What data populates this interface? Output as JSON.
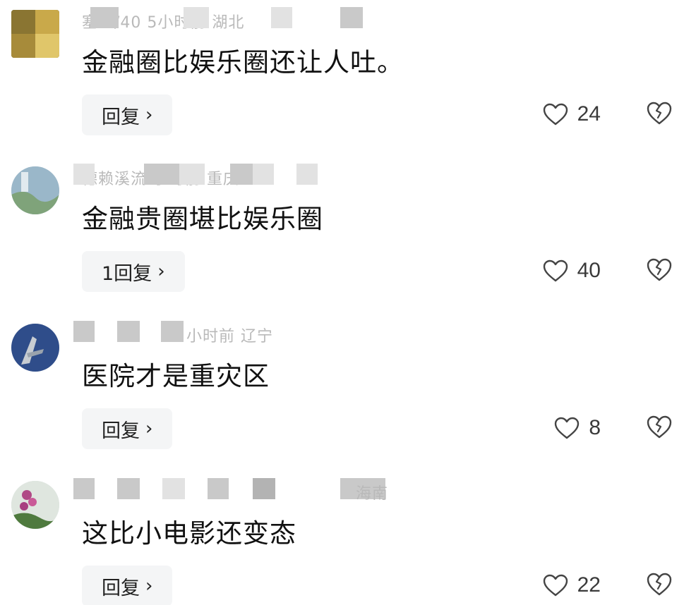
{
  "comments": [
    {
      "meta": "塞 3/40 5小时前 湖北",
      "text": "金融圈比娱乐圈还让人吐。",
      "reply_label": "回复",
      "likes": "24"
    },
    {
      "meta": "德赖溪流 小时前 重庆",
      "text": "金融贵圈堪比娱乐圈",
      "reply_label": "1回复",
      "likes": "40"
    },
    {
      "meta": "小时前 辽宁",
      "text": "医院才是重灾区",
      "reply_label": "回复",
      "likes": "8"
    },
    {
      "meta": "海南",
      "text": "这比小电影还变态",
      "reply_label": "回复",
      "likes": "22"
    }
  ],
  "icons": {
    "like": "heart-outline-icon",
    "dislike": "broken-heart-icon",
    "reply_chevron": "chevron-right-icon"
  },
  "colors": {
    "text": "#111111",
    "meta": "#b9b9b9",
    "reply_bg": "#f4f5f6",
    "icon": "#444444"
  }
}
